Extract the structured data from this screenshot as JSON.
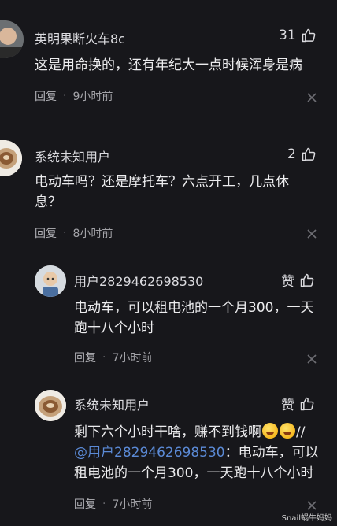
{
  "comments": [
    {
      "username": "英明果断火车8c",
      "likes": "31",
      "text": "这是用命换的，还有年纪大一点时候浑身是病",
      "reply_label": "回复",
      "time": "9小时前"
    },
    {
      "username": "系统未知用户",
      "likes": "2",
      "text_line1": "电动车吗？还是摩托车？六点开工，几点休",
      "text_line2": "息？",
      "reply_label": "回复",
      "time": "8小时前"
    }
  ],
  "replies": [
    {
      "username": "用户2829462698530",
      "like_label": "赞",
      "text_line1": "电动车，可以租电池的一个月300，一天",
      "text_line2": "跑十八个小时",
      "reply_label": "回复",
      "time": "7小时前"
    },
    {
      "username": "系统未知用户",
      "like_label": "赞",
      "text_line1": "剩下六个小时干啥，赚不到钱啊",
      "text_line1_tail": "//",
      "mention": "@用户2829462698530",
      "text_line2_rest": "：电动车，可以",
      "text_line3": "租电池的一个月300，一天跑十八个小时",
      "reply_label": "回复",
      "time": "7小时前"
    }
  ],
  "icons": {
    "like": "thumbs-up-icon",
    "close": "close-icon",
    "emoji": [
      "rolling-laughing-emoji",
      "crying-laughing-emoji"
    ]
  },
  "colors": {
    "background": "#17171b",
    "mention": "#5b8ad6"
  },
  "watermark": "Snail蜗牛妈妈"
}
